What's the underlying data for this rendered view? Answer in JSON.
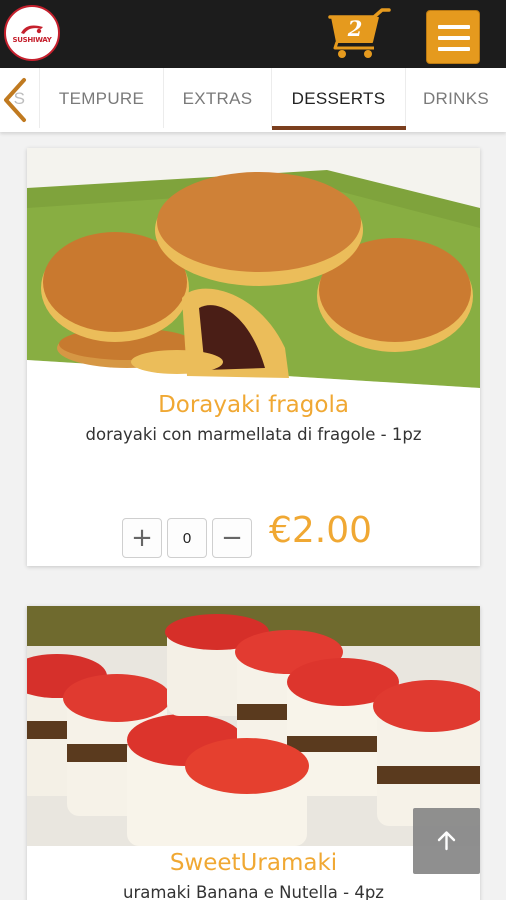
{
  "header": {
    "logo_text": "SUSHIWAY",
    "cart_count": "2",
    "colors": {
      "bar": "#1c1c1c",
      "accent": "#e59a1e"
    }
  },
  "tabs": {
    "items": [
      {
        "label": "S",
        "active": false
      },
      {
        "label": "TEMPURE",
        "active": false
      },
      {
        "label": "EXTRAS",
        "active": false
      },
      {
        "label": "DESSERTS",
        "active": true
      },
      {
        "label": "DRINKS",
        "active": false
      }
    ],
    "prev_icon": "chevron-left-icon",
    "active_color": "#7b3f1e"
  },
  "products": [
    {
      "title": "Dorayaki fragola",
      "description": "dorayaki con marmellata di fragole - 1pz",
      "quantity": "0",
      "plus_label": "+",
      "minus_label": "−",
      "price": "€2.00"
    },
    {
      "title": "SweetUramaki",
      "description": "uramaki Banana e Nutella - 4pz"
    }
  ],
  "scroll_top_icon": "arrow-up-icon",
  "title_color": "#f0a833"
}
